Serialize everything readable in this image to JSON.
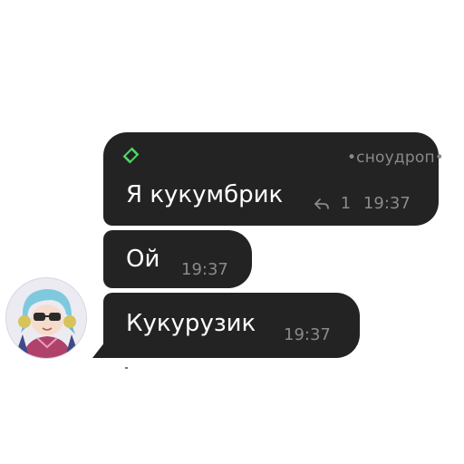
{
  "messages": [
    {
      "sender_name": "•сноудроп•",
      "text": "Я кукумбрик",
      "reply_count": "1",
      "time": "19:37"
    },
    {
      "text": "Ой",
      "time": "19:37"
    },
    {
      "text": "Кукурузик",
      "time": "19:37"
    }
  ],
  "icons": {
    "badge": "diamond-badge-icon",
    "reply": "reply-arrow-icon",
    "avatar": "anime-avatar"
  },
  "colors": {
    "bubble": "#232323",
    "badge": "#4cd964",
    "meta": "#8a8a8a",
    "text": "#ffffff"
  }
}
